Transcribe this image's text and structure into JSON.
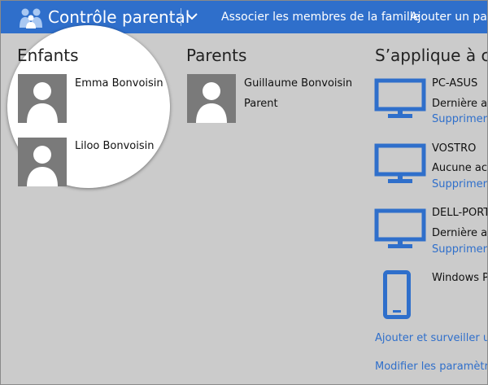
{
  "header": {
    "app_title": "Contrôle parental",
    "nav": [
      "Associer les membres de la famille",
      "Ajouter un parent"
    ],
    "brand_color": "#2f6fcb"
  },
  "children": {
    "title": "Enfants",
    "members": [
      {
        "name": "Emma Bonvoisin",
        "highlighted": true
      },
      {
        "name": "Liloo Bonvoisin"
      }
    ]
  },
  "parents": {
    "title": "Parents",
    "members": [
      {
        "name": "Guillaume Bonvoisin",
        "role": "Parent"
      }
    ]
  },
  "devices": {
    "title": "S’applique à ces appareils",
    "items": [
      {
        "name": "PC-ASUS",
        "status": "Dernière activité",
        "action": "Supprimer",
        "icon": "monitor-icon"
      },
      {
        "name": "VOSTRO",
        "status": "Aucune activité",
        "action": "Supprimer",
        "icon": "monitor-icon"
      },
      {
        "name": "DELL-PORTABLE",
        "status": "Dernière activité",
        "action": "Supprimer",
        "icon": "monitor-icon"
      },
      {
        "name": "Windows Phone",
        "icon": "phone-icon"
      }
    ],
    "add_link": "Ajouter et surveiller un appareil",
    "settings_link": "Modifier les paramètres"
  }
}
